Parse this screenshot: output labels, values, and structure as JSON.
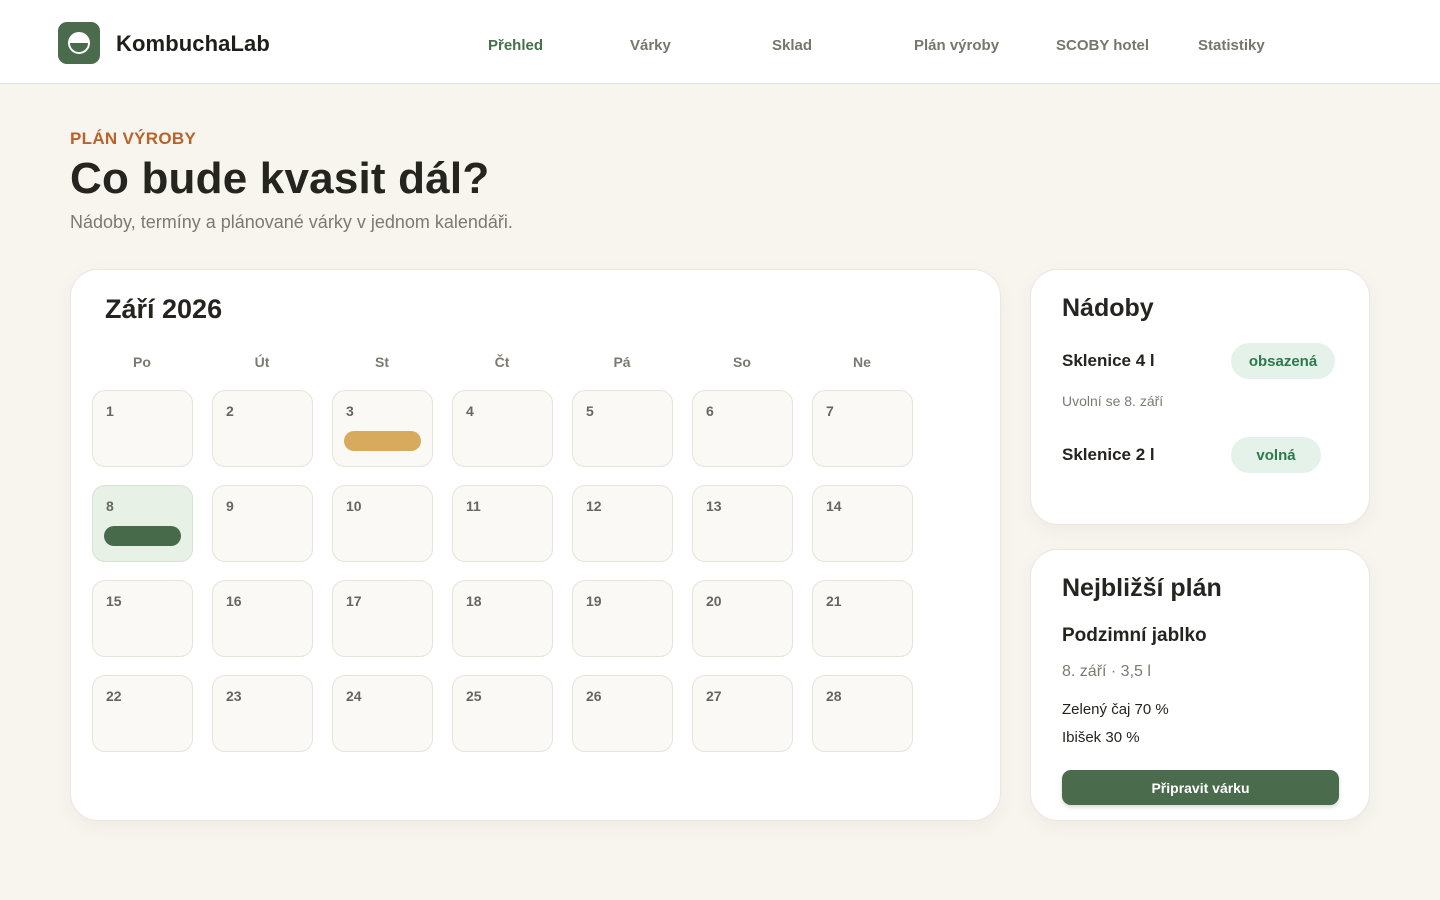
{
  "app": {
    "name": "KombuchaLab",
    "logo_icon": "kombucha-jar-icon"
  },
  "nav": [
    {
      "label": "Přehled",
      "active": true
    },
    {
      "label": "Várky",
      "active": false
    },
    {
      "label": "Sklad",
      "active": false
    },
    {
      "label": "Plán výroby",
      "active": false
    },
    {
      "label": "SCOBY hotel",
      "active": false
    },
    {
      "label": "Statistiky",
      "active": false
    }
  ],
  "hero": {
    "eyebrow": "PLÁN VÝROBY",
    "title": "Co bude kvasit dál?",
    "subtitle": "Nádoby, termíny a plánované várky v jednom kalendáři."
  },
  "calendar": {
    "month_label": "Září 2026",
    "weekdays": [
      "Po",
      "Út",
      "St",
      "Čt",
      "Pá",
      "So",
      "Ne"
    ],
    "weeks": [
      [
        "1",
        "2",
        "3",
        "4",
        "5",
        "6",
        "7"
      ],
      [
        "8",
        "9",
        "10",
        "11",
        "12",
        "13",
        "14"
      ],
      [
        "15",
        "16",
        "17",
        "18",
        "19",
        "20",
        "21"
      ],
      [
        "22",
        "23",
        "24",
        "25",
        "26",
        "27",
        "28"
      ]
    ],
    "highlighted_day": "8",
    "events": [
      {
        "day": "3",
        "color": "#d8aa5e"
      },
      {
        "day": "8",
        "color": "#466a4a"
      }
    ]
  },
  "vessels": {
    "title": "Nádoby",
    "items": [
      {
        "name": "Sklenice 4 l",
        "status": "obsazená",
        "note": "Uvolní se 8. září"
      },
      {
        "name": "Sklenice 2 l",
        "status": "volná",
        "note": ""
      }
    ]
  },
  "next_plan": {
    "title": "Nejbližší plán",
    "name": "Podzimní jablko",
    "meta": "8. září · 3,5 l",
    "ingredients": [
      "Zelený čaj 70 %",
      "Ibišek 30 %"
    ],
    "button_label": "Připravit várku"
  },
  "colors": {
    "accent": "#4a6b4c",
    "eyebrow": "#b8632a",
    "background": "#f7f5ee",
    "badge_bg": "#e5f2e9",
    "badge_text": "#2b7a4f"
  }
}
